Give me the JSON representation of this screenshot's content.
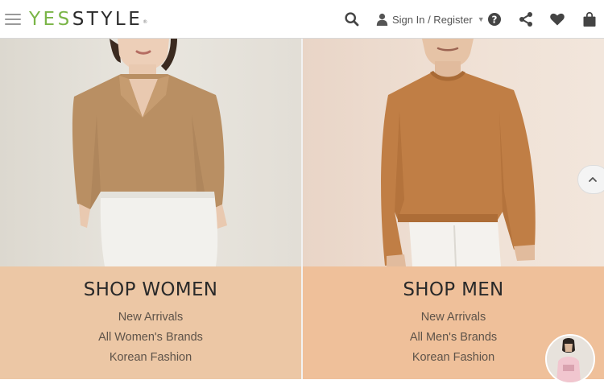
{
  "header": {
    "logo": {
      "yes": "YES",
      "style": "STYLE",
      "reg": "®"
    },
    "signin_label": "Sign In / Register",
    "icons": [
      "hamburger-menu-icon",
      "search-icon",
      "user-icon",
      "help-icon",
      "share-icon",
      "heart-icon",
      "shopping-bag-icon"
    ]
  },
  "panels": {
    "women": {
      "title": "SHOP WOMEN",
      "links": [
        "New Arrivals",
        "All Women's Brands",
        "Korean Fashion"
      ]
    },
    "men": {
      "title": "SHOP MEN",
      "links": [
        "New Arrivals",
        "All Men's Brands",
        "Korean Fashion"
      ]
    }
  },
  "floating": {
    "scroll_top_icon": "chevron-up-icon",
    "avatar": "model-thumbnail"
  },
  "colors": {
    "brand_green": "#7ab547",
    "women_block": "#ecc7a5",
    "men_block": "#efc09a",
    "link_text": "#5e5349"
  }
}
